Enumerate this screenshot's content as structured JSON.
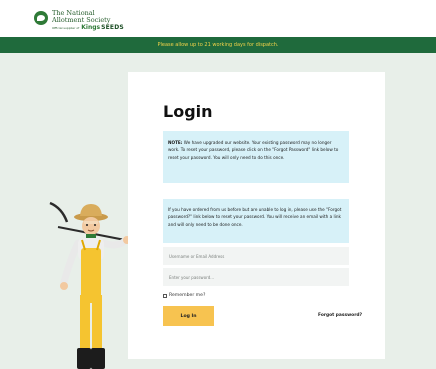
{
  "header": {
    "logo_line1": "The National",
    "logo_line2": "Allotment Society",
    "logo_small": "Official supplier of",
    "logo_kings": "Kings",
    "logo_seeds": "SEEDS",
    "banner_text": "Please allow up to 21 working days for dispatch."
  },
  "login": {
    "title": "Login",
    "notice1": {
      "label": "NOTE:",
      "text": " We have upgraded our website. Your existing password may no longer work. To reset your password, please click on the \"Forgot Password\" link below to reset your password. You will only need to do this once."
    },
    "notice2": "If you have ordered from us before but are unable to log in, please use the \"Forgot password?\" link below to reset your password. You will receive an email with a link and will only need to be done once.",
    "username_placeholder": "Username or Email Address",
    "password_placeholder": "Enter your password...",
    "remember_label": "Remember me?",
    "login_button": "Log In",
    "forgot_link": "Forgot password?"
  },
  "colors": {
    "banner_bg": "#1f6a3c",
    "banner_text": "#f2d34a",
    "notice_bg": "#d7f1f8",
    "button_bg": "#f7c350",
    "page_bg": "#e8efe9"
  }
}
